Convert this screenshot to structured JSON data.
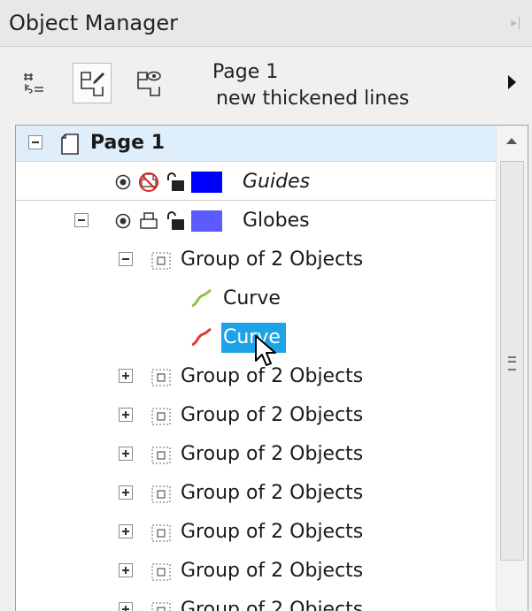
{
  "panel": {
    "title": "Object Manager"
  },
  "toolbar": {
    "page_name": "Page 1",
    "layer_name": "new thickened lines",
    "buttons": [
      {
        "icon": "show-properties-icon"
      },
      {
        "icon": "edit-across-layers-icon"
      },
      {
        "icon": "layer-manager-view-icon"
      }
    ],
    "menu_icon": "flyout-arrow-icon"
  },
  "tree": {
    "page": {
      "label": "Page 1",
      "expanded": true
    },
    "guides": {
      "label": "Guides",
      "color": "#0000ff"
    },
    "globes": {
      "label": "Globes",
      "color": "#5b5bff",
      "expanded": true
    },
    "group_open": {
      "label": "Group of 2 Objects",
      "expanded": true
    },
    "curves": [
      {
        "label": "Curve",
        "color": "#8cc63f",
        "selected": false
      },
      {
        "label": "Curve",
        "color": "#e53935",
        "selected": true
      }
    ],
    "groups": [
      {
        "label": "Group of 2 Objects"
      },
      {
        "label": "Group of 2 Objects"
      },
      {
        "label": "Group of 2 Objects"
      },
      {
        "label": "Group of 2 Objects"
      },
      {
        "label": "Group of 2 Objects"
      },
      {
        "label": "Group of 2 Objects"
      },
      {
        "label": "Group of 2 Objects"
      }
    ]
  },
  "colors": {
    "selection": "#1ea3e8",
    "page_row": "#dfeefb"
  }
}
